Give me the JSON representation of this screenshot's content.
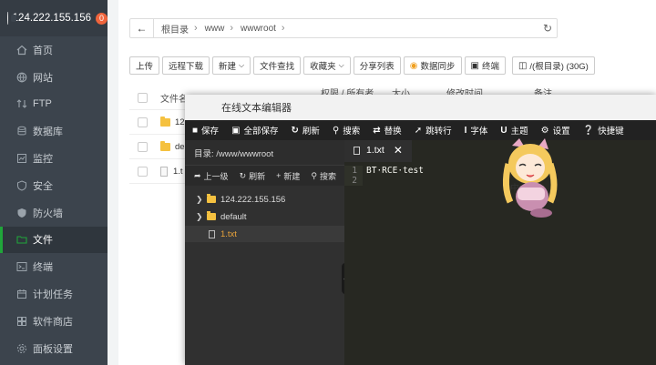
{
  "sidebar": {
    "ip": "124.222.155.156",
    "badge": "0",
    "items": [
      {
        "label": "首页",
        "icon": "home-icon"
      },
      {
        "label": "网站",
        "icon": "globe-icon"
      },
      {
        "label": "FTP",
        "icon": "ftp-icon"
      },
      {
        "label": "数据库",
        "icon": "database-icon"
      },
      {
        "label": "监控",
        "icon": "monitor-icon"
      },
      {
        "label": "安全",
        "icon": "shield-icon"
      },
      {
        "label": "防火墙",
        "icon": "firewall-icon"
      },
      {
        "label": "文件",
        "icon": "folder-icon",
        "active": true
      },
      {
        "label": "终端",
        "icon": "terminal-icon"
      },
      {
        "label": "计划任务",
        "icon": "calendar-icon"
      },
      {
        "label": "软件商店",
        "icon": "store-icon"
      },
      {
        "label": "面板设置",
        "icon": "settings-icon"
      }
    ]
  },
  "breadcrumb": {
    "segments": [
      "根目录",
      "www",
      "wwwroot"
    ]
  },
  "toolbar": {
    "upload": "上传",
    "remote_download": "远程下载",
    "new": "新建",
    "file_search": "文件查找",
    "favorites": "收藏夹",
    "share_list": "分享列表",
    "data_sync": "数据同步",
    "terminal": "终端",
    "disk": "/(根目录) (30G)"
  },
  "file_table": {
    "col_name": "文件名",
    "col_perm": "权限 / 所有者",
    "col_size": "大小",
    "col_mtime": "修改时间",
    "col_note": "备注",
    "rows": [
      {
        "name": "12",
        "type": "folder"
      },
      {
        "name": "de",
        "type": "folder"
      },
      {
        "name": "1.t",
        "type": "file"
      }
    ]
  },
  "editor": {
    "title": "在线文本编辑器",
    "tools": [
      {
        "label": "保存",
        "icon": "save-icon"
      },
      {
        "label": "全部保存",
        "icon": "save-all-icon"
      },
      {
        "label": "刷新",
        "icon": "refresh-icon"
      },
      {
        "label": "搜索",
        "icon": "search-icon"
      },
      {
        "label": "替换",
        "icon": "replace-icon"
      },
      {
        "label": "跳转行",
        "icon": "jump-icon"
      },
      {
        "label": "字体",
        "icon": "font-icon"
      },
      {
        "label": "主题",
        "icon": "theme-icon"
      },
      {
        "label": "设置",
        "icon": "gear-icon"
      },
      {
        "label": "快捷键",
        "icon": "help-icon"
      }
    ],
    "dir_label": "目录: /www/wwwroot",
    "subtools": {
      "up": "上一级",
      "refresh": "刷新",
      "new": "新建",
      "search": "搜索"
    },
    "tree": [
      {
        "name": "124.222.155.156",
        "type": "folder"
      },
      {
        "name": "default",
        "type": "folder"
      },
      {
        "name": "1.txt",
        "type": "file"
      }
    ],
    "tab": "1.txt",
    "code_lines": [
      {
        "no": "1",
        "text": "BT·RCE·test"
      },
      {
        "no": "2",
        "text": ""
      }
    ]
  }
}
